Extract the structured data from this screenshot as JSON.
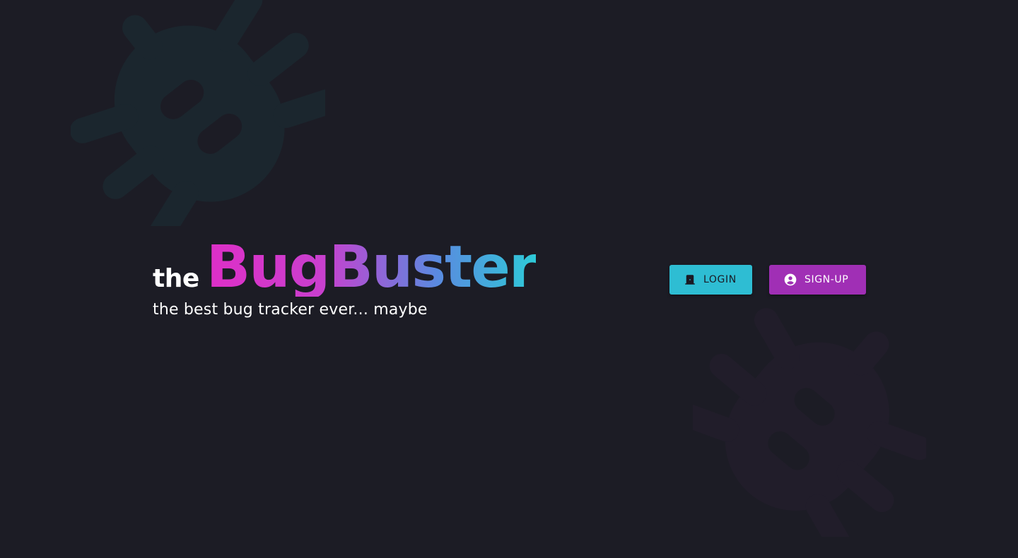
{
  "hero": {
    "prefix": "the",
    "brand": "BugBuster",
    "tagline": "the best bug tracker ever... maybe"
  },
  "auth": {
    "login_label": "LOGIN",
    "signup_label": "SIGN-UP"
  },
  "icons": {
    "login": "door-icon",
    "signup": "account-circle-icon",
    "background": "bug-icon"
  },
  "colors": {
    "background": "#1c1c25",
    "login_button": "#2ebdd3",
    "signup_button": "#a02fb5",
    "gradient_start": "#de2fc7",
    "gradient_end": "#2ecad8"
  }
}
